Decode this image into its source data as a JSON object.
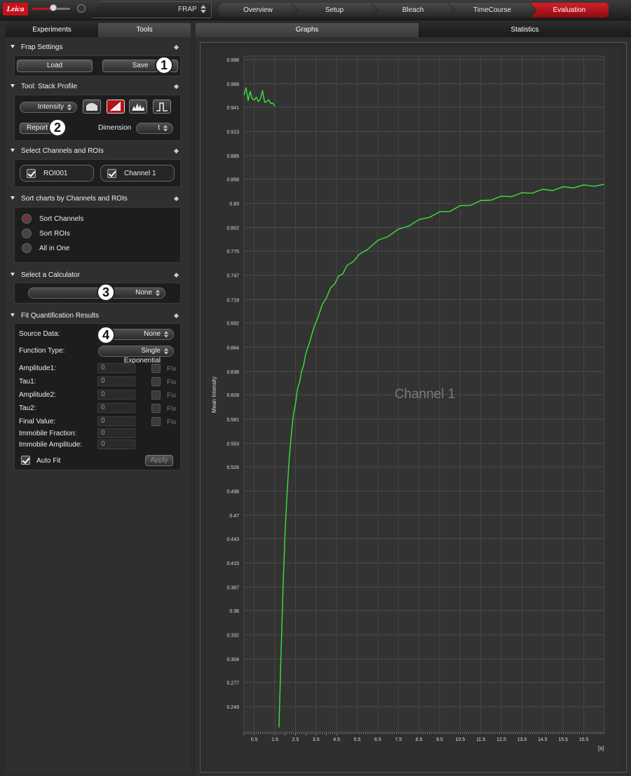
{
  "topbar": {
    "logo": "Leica",
    "brightness_level": 0.55,
    "mode": "FRAP",
    "steps": [
      {
        "label": "Overview",
        "active": false
      },
      {
        "label": "Setup",
        "active": false
      },
      {
        "label": "Bleach",
        "active": false
      },
      {
        "label": "TimeCourse",
        "active": false
      },
      {
        "label": "Evaluation",
        "active": true
      }
    ],
    "accent_color": "#c8121b"
  },
  "left_tabs": {
    "experiments": "Experiments",
    "tools": "Tools",
    "active": "Tools"
  },
  "frap_settings": {
    "title": "Frap Settings",
    "load": "Load",
    "save": "Save"
  },
  "stack_profile": {
    "title": "Tool: Stack Profile",
    "intensity": "Intensity",
    "icons": [
      "profile-shape-icon",
      "diagonal-profile-icon",
      "histogram-icon",
      "peak-icon"
    ],
    "report": "Report",
    "dimension_label": "Dimension",
    "dimension_value": "t"
  },
  "channels_rois": {
    "title": "Select Channels and ROIs",
    "roi": "ROI001",
    "channel": "Channel 1"
  },
  "sort_charts": {
    "title": "Sort charts by Channels and ROIs",
    "options": [
      "Sort Channels",
      "Sort ROIs",
      "All in One"
    ],
    "selected": "Sort Channels"
  },
  "calculator": {
    "title": "Select a Calculator",
    "value": "None"
  },
  "fit": {
    "title": "Fit Quantification Results",
    "source_label": "Source Data:",
    "source_value": "None",
    "function_label": "Function Type:",
    "function_value": "Single Exponential",
    "params": [
      {
        "label": "Amplitude1:",
        "value": "0",
        "fix": "Fix"
      },
      {
        "label": "Tau1:",
        "value": "0",
        "fix": "Fix"
      },
      {
        "label": "Amplitude2:",
        "value": "0",
        "fix": "Fix"
      },
      {
        "label": "Tau2:",
        "value": "0",
        "fix": "Fix"
      },
      {
        "label": "Final Value:",
        "value": "0",
        "fix": "Fix"
      }
    ],
    "immobile_fraction_label": "Immobile Fraction:",
    "immobile_fraction_value": "0",
    "immobile_amplitude_label": "Immobile Amplitude:",
    "immobile_amplitude_value": "0",
    "auto_fit": "Auto Fit",
    "apply": "Apply"
  },
  "callouts": [
    "1",
    "2",
    "3",
    "4"
  ],
  "right_tabs": {
    "graphs": "Graphs",
    "statistics": "Statistics",
    "active": "Graphs"
  },
  "chart_data": {
    "type": "line",
    "watermark": "Channel 1",
    "ylabel": "Mean Intensity",
    "xunit": "[s]",
    "y_ticks": [
      "0.996",
      "0.968",
      "0.941",
      "0.913",
      "0.885",
      "0.858",
      "0.83",
      "0.802",
      "0.775",
      "0.747",
      "0.719",
      "0.692",
      "0.664",
      "0.636",
      "0.609",
      "0.581",
      "0.553",
      "0.526",
      "0.498",
      "0.47",
      "0.443",
      "0.415",
      "0.387",
      "0.36",
      "0.332",
      "0.304",
      "0.277",
      "0.249"
    ],
    "x_ticks": [
      "0.5",
      "1.5",
      "2.5",
      "3.5",
      "4.5",
      "5.5",
      "6.5",
      "7.5",
      "8.5",
      "9.5",
      "10.5",
      "11.5",
      "12.5",
      "13.5",
      "14.5",
      "15.5",
      "16.5"
    ],
    "xlim": [
      0,
      17.5
    ],
    "ylim": [
      0.22,
      1.0
    ],
    "grid": true,
    "line_color": "#3ae23a",
    "series": [
      {
        "segment": "pre-bleach",
        "x": [
          0,
          0.1,
          0.2,
          0.3,
          0.4,
          0.5,
          0.6,
          0.7,
          0.8,
          0.9,
          1.0,
          1.1,
          1.2,
          1.3,
          1.4,
          1.5
        ],
        "y": [
          0.955,
          0.962,
          0.95,
          0.958,
          0.952,
          0.948,
          0.954,
          0.946,
          0.952,
          0.959,
          0.948,
          0.946,
          0.951,
          0.944,
          0.947,
          0.942
        ]
      },
      {
        "segment": "recovery",
        "x": [
          1.7,
          1.8,
          1.9,
          2.0,
          2.1,
          2.2,
          2.3,
          2.4,
          2.5,
          2.6,
          2.7,
          2.8,
          2.9,
          3.0,
          3.2,
          3.4,
          3.6,
          3.8,
          4.0,
          4.2,
          4.4,
          4.6,
          4.8,
          5.0,
          5.3,
          5.6,
          6.0,
          6.5,
          7.0,
          7.5,
          8.0,
          8.5,
          9.0,
          9.5,
          10.0,
          10.5,
          11.0,
          11.5,
          12.0,
          12.5,
          13.0,
          13.5,
          14.0,
          14.5,
          15.0,
          15.5,
          16.0,
          16.5,
          17.0,
          17.5
        ],
        "y": [
          0.225,
          0.31,
          0.39,
          0.45,
          0.5,
          0.535,
          0.565,
          0.585,
          0.6,
          0.615,
          0.625,
          0.635,
          0.645,
          0.655,
          0.672,
          0.686,
          0.7,
          0.712,
          0.722,
          0.731,
          0.738,
          0.745,
          0.75,
          0.757,
          0.764,
          0.77,
          0.778,
          0.786,
          0.793,
          0.799,
          0.805,
          0.81,
          0.815,
          0.819,
          0.822,
          0.826,
          0.829,
          0.832,
          0.835,
          0.837,
          0.839,
          0.841,
          0.843,
          0.845,
          0.846,
          0.848,
          0.849,
          0.85,
          0.851,
          0.852
        ]
      }
    ]
  }
}
